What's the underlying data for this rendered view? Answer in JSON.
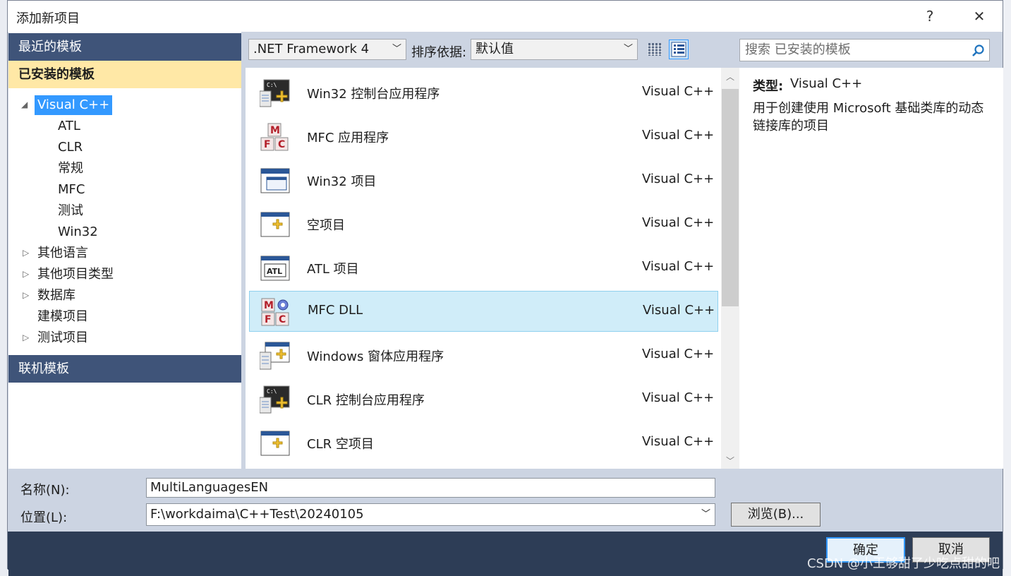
{
  "dialog": {
    "title": "添加新项目",
    "help_label": "?",
    "close_label": "✕"
  },
  "left_panel": {
    "recent_label": "最近的模板",
    "installed_label": "已安装的模板",
    "online_label": "联机模板",
    "tree": [
      {
        "label": "Visual C++",
        "selected": true,
        "expander": "◢"
      },
      {
        "label": "ATL"
      },
      {
        "label": "CLR"
      },
      {
        "label": "常规"
      },
      {
        "label": "MFC"
      },
      {
        "label": "测试"
      },
      {
        "label": "Win32"
      },
      {
        "label": "其他语言",
        "expander": "▷"
      },
      {
        "label": "其他项目类型",
        "expander": "▷"
      },
      {
        "label": "数据库",
        "expander": "▷"
      },
      {
        "label": "建模项目"
      },
      {
        "label": "测试项目",
        "expander": "▷"
      }
    ]
  },
  "toolbar": {
    "framework": ".NET Framework 4",
    "sort_label": "排序依据:",
    "sort_value": "默认值",
    "search_placeholder": "搜索 已安装的模板"
  },
  "templates": [
    {
      "name": "Win32 控制台应用程序",
      "lang": "Visual C++",
      "icon": "console-app-icon"
    },
    {
      "name": "MFC 应用程序",
      "lang": "Visual C++",
      "icon": "mfc-icon"
    },
    {
      "name": "Win32 项目",
      "lang": "Visual C++",
      "icon": "window-icon"
    },
    {
      "name": "空项目",
      "lang": "Visual C++",
      "icon": "empty-project-icon"
    },
    {
      "name": "ATL 项目",
      "lang": "Visual C++",
      "icon": "atl-icon"
    },
    {
      "name": "MFC DLL",
      "lang": "Visual C++",
      "icon": "mfc-dll-icon",
      "selected": true
    },
    {
      "name": "Windows 窗体应用程序",
      "lang": "Visual C++",
      "icon": "forms-app-icon"
    },
    {
      "name": "CLR 控制台应用程序",
      "lang": "Visual C++",
      "icon": "console-app-icon"
    },
    {
      "name": "CLR 空项目",
      "lang": "Visual C++",
      "icon": "empty-project-icon"
    }
  ],
  "details": {
    "type_label": "类型:",
    "type_value": "Visual C++",
    "description": "用于创建使用 Microsoft 基础类库的动态链接库的项目"
  },
  "form": {
    "name_label": "名称(N):",
    "name_value": "MultiLanguagesEN",
    "location_label": "位置(L):",
    "location_value": "F:\\workdaima\\C++Test\\20240105",
    "browse_label": "浏览(B)...",
    "ok_label": "确定",
    "cancel_label": "取消"
  },
  "watermark": "CSDN @小王够甜了少吃点甜的吧",
  "colors": {
    "header": "#3f5479",
    "installed": "#ffe8a6",
    "selection": "#3399ff",
    "row_selected": "#d0edf9"
  }
}
